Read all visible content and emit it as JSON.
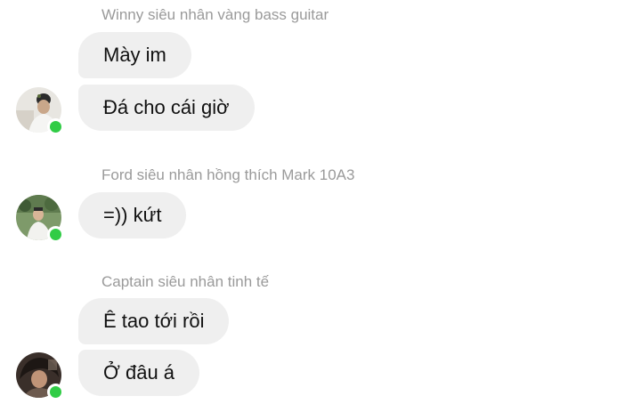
{
  "messages": [
    {
      "sender": "Winny siêu nhân vàng bass guitar",
      "avatar_icon": "user-avatar-photo",
      "online": true,
      "bubbles": [
        "Mày im",
        "Đá cho cái giờ"
      ]
    },
    {
      "sender": "Ford siêu nhân hồng thích Mark 10A3",
      "avatar_icon": "user-avatar-photo",
      "online": true,
      "bubbles": [
        "=)) kứt"
      ]
    },
    {
      "sender": "Captain siêu nhân tinh tế",
      "avatar_icon": "user-avatar-photo",
      "online": true,
      "bubbles": [
        "Ê tao tới rồi",
        "Ở đâu á"
      ]
    }
  ],
  "colors": {
    "bubble_bg": "#efefef",
    "sender_name": "#9a9a9a",
    "online_indicator": "#31cc46"
  }
}
